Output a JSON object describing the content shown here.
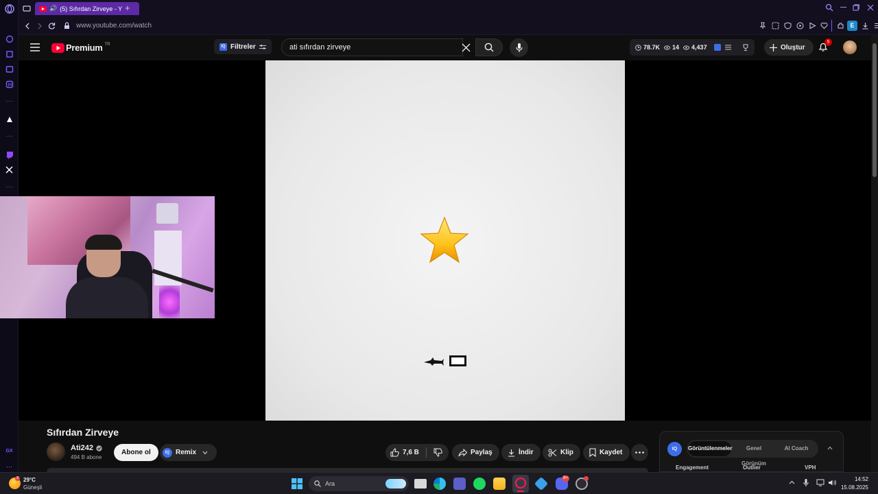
{
  "browser": {
    "tab_title": "(5) Sıfırdan Zirveye - Y",
    "url": "www.youtube.com/watch",
    "extension_badge": "E"
  },
  "yt_header": {
    "logo_text": "Premium",
    "logo_region": "TR",
    "filters_label": "Filtreler",
    "search_query": "ati sıfırdan zirveye",
    "stats": [
      "78.7K",
      "14",
      "4,437"
    ],
    "create_label": "Oluştur",
    "notification_count": "5"
  },
  "video": {
    "title": "Sıfırdan Zirveye",
    "channel_name": "Ati242",
    "subscribers": "494 B abone",
    "subscribe_label": "Abone ol",
    "remix_label": "Remix",
    "likes": "7,6 B",
    "share_label": "Paylaş",
    "download_label": "İndir",
    "clip_label": "Klip",
    "save_label": "Kaydet"
  },
  "iq_panel": {
    "tabs": [
      "Görüntülenmeler",
      "Genel Görünüm",
      "AI Coach"
    ],
    "columns": [
      "Engagement",
      "Outlier",
      "VPH"
    ]
  },
  "taskbar": {
    "weather_temp": "29°C",
    "weather_desc": "Güneşli",
    "search_placeholder": "Ara",
    "time": "14:52",
    "date": "15.08.2025",
    "discord_badge": "9+"
  },
  "colors": {
    "opera_accent": "#5b2aa4",
    "youtube_red": "#ff0033",
    "iq_blue": "#3d6ee8"
  }
}
